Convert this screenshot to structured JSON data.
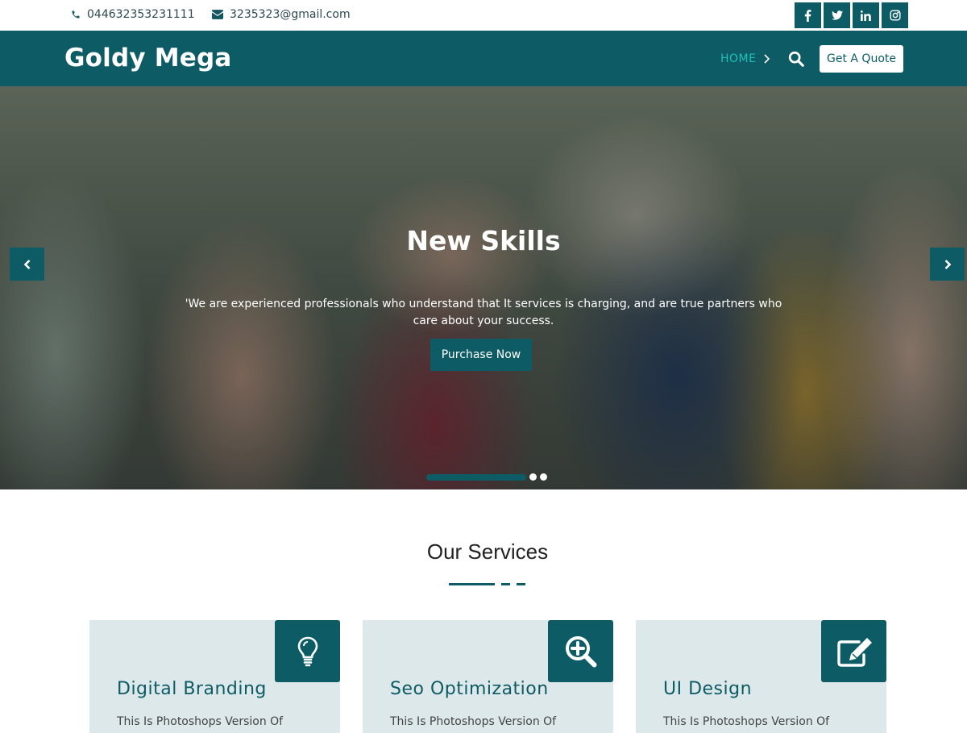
{
  "topbar": {
    "phone": "044632353231111",
    "email": "3235323@gmail.com",
    "socials": [
      "facebook-icon",
      "twitter-icon",
      "linkedin-icon",
      "instagram-icon"
    ]
  },
  "header": {
    "brand": "Goldy Mega",
    "nav_home": "HOME",
    "quote_label": "Get A Quote"
  },
  "hero": {
    "title": "New Skills",
    "text": "'We are experienced professionals who understand that It services is charging, and are true partners who care about your success.",
    "button_label": "Purchase Now",
    "slide_count": 3,
    "active_slide": 1
  },
  "services": {
    "title": "Our Services",
    "cards": [
      {
        "title": "Digital Branding",
        "text": "This Is Photoshops Version Of",
        "icon": "lightbulb-icon"
      },
      {
        "title": "Seo Optimization",
        "text": "This Is Photoshops Version Of",
        "icon": "search-plus-icon"
      },
      {
        "title": "UI Design",
        "text": "This Is Photoshops Version Of",
        "icon": "edit-icon"
      }
    ]
  },
  "colors": {
    "primary": "#0d5b64",
    "accent": "#1fc0b6",
    "card_bg": "#dce8e9"
  }
}
